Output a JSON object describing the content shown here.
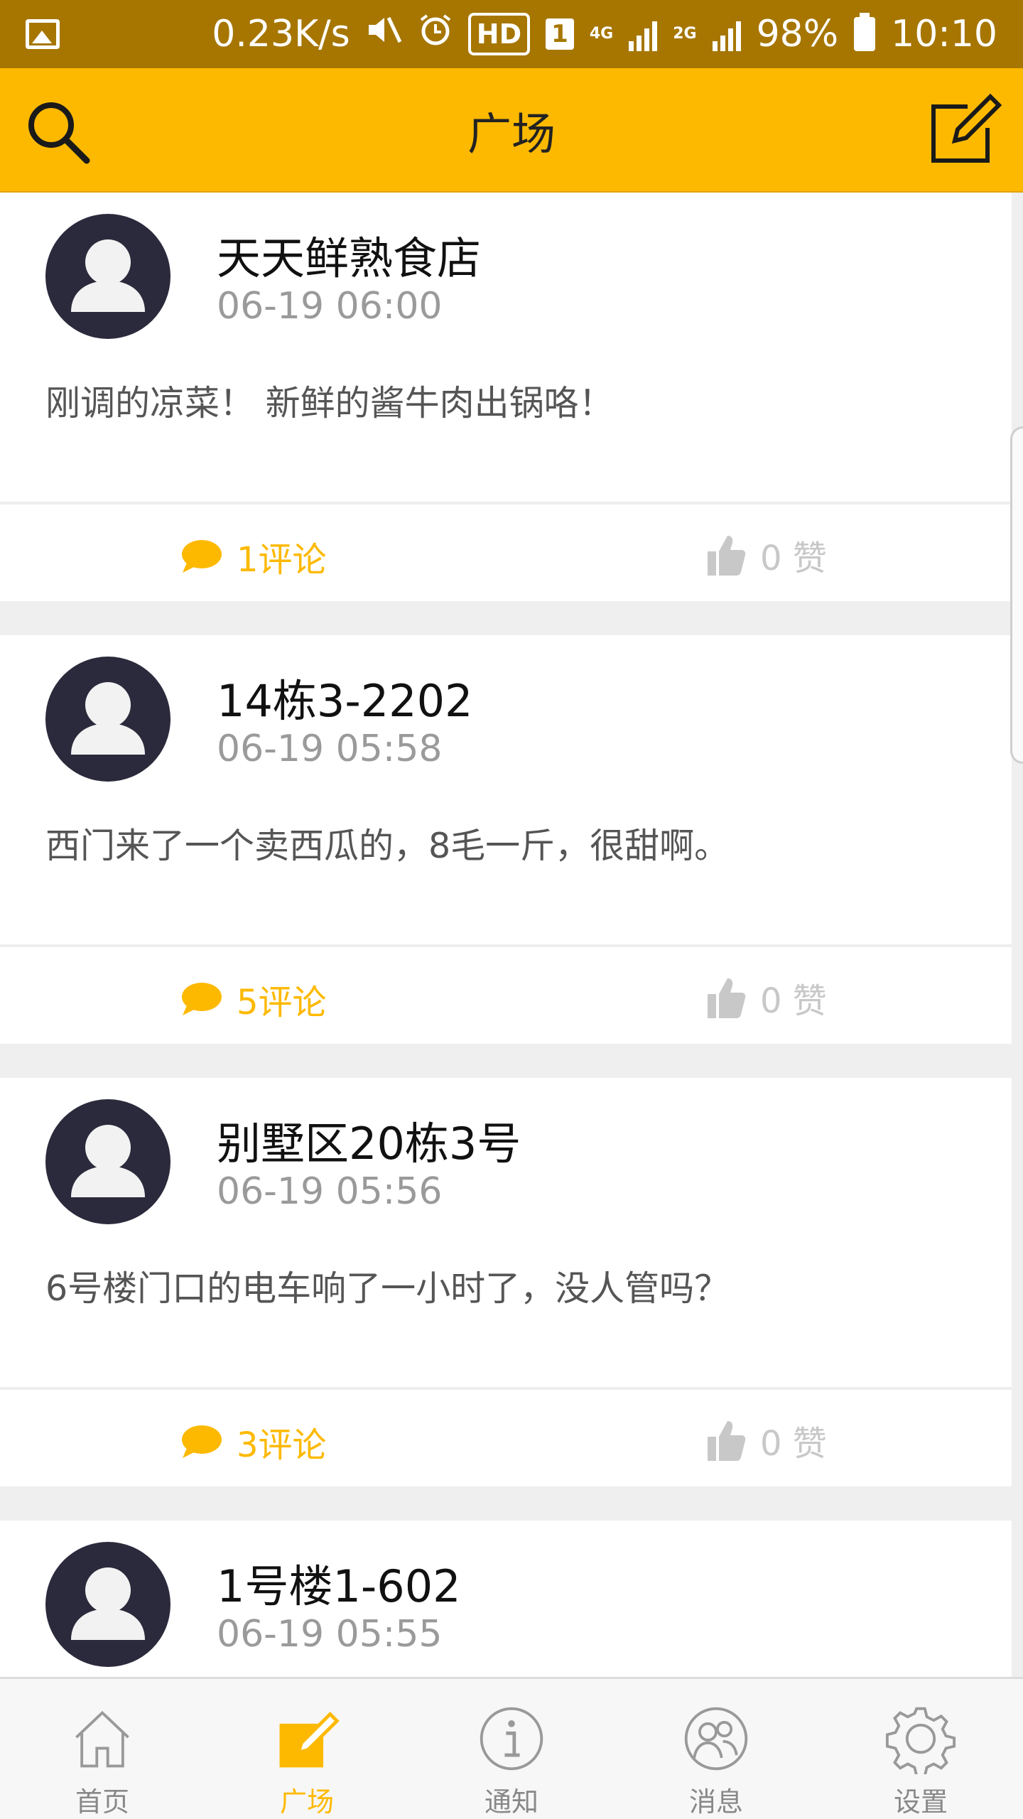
{
  "status_bar": {
    "speed": "0.23K/s",
    "hd": "HD",
    "sim": "1",
    "net_4g": "4G",
    "net_2g": "2G",
    "battery": "98%",
    "time": "10:10"
  },
  "header": {
    "title": "广场"
  },
  "posts": [
    {
      "author": "天天鲜熟食店",
      "time": "06-19 06:00",
      "content": "刚调的凉菜！ 新鲜的酱牛肉出锅咯！",
      "comments": "1评论",
      "likes": "0 赞"
    },
    {
      "author": "14栋3-2202",
      "time": "06-19 05:58",
      "content": "西门来了一个卖西瓜的，8毛一斤，很甜啊。",
      "comments": "5评论",
      "likes": "0 赞"
    },
    {
      "author": "别墅区20栋3号",
      "time": "06-19 05:56",
      "content": "6号楼门口的电车响了一小时了，没人管吗？",
      "comments": "3评论",
      "likes": "0 赞"
    },
    {
      "author": "1号楼1-602",
      "time": "06-19 05:55",
      "content": "",
      "comments": "",
      "likes": ""
    }
  ],
  "bottom_nav": [
    {
      "label": "首页",
      "icon": "home-icon",
      "active": false
    },
    {
      "label": "广场",
      "icon": "edit-square-icon",
      "active": true
    },
    {
      "label": "通知",
      "icon": "info-icon",
      "active": false
    },
    {
      "label": "消息",
      "icon": "users-icon",
      "active": false
    },
    {
      "label": "设置",
      "icon": "gear-icon",
      "active": false
    }
  ],
  "colors": {
    "status_bar": "#a67600",
    "accent": "#fdb900",
    "avatar_bg": "#2b2a3c",
    "inactive": "#888888"
  }
}
